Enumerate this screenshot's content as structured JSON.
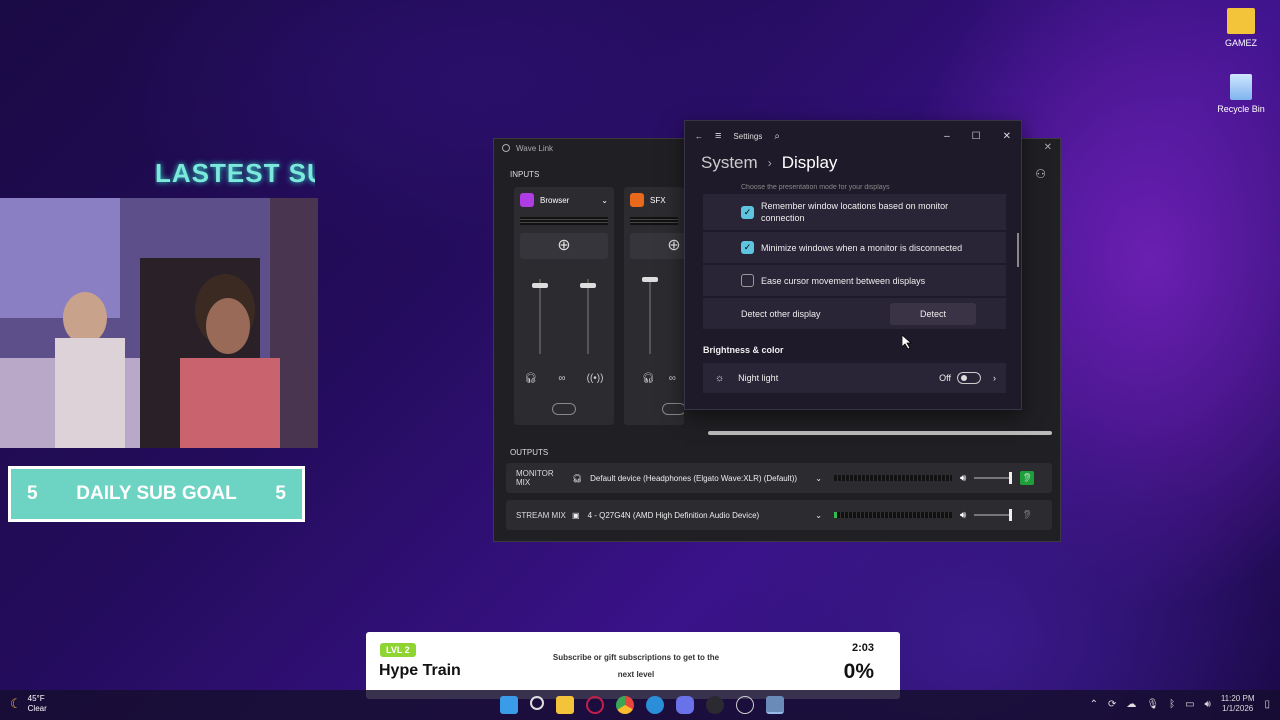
{
  "desktop": {
    "icons": [
      {
        "label": "GAMEZ",
        "icon": "folder-icon"
      },
      {
        "label": "Recycle Bin",
        "icon": "recycle-bin-icon"
      }
    ]
  },
  "overlay": {
    "latest_label": "LASTEST SU",
    "subgoal": {
      "left": "5",
      "label": "DAILY SUB GOAL",
      "right": "5"
    }
  },
  "wavelink": {
    "title": "Wave Link",
    "inputs_label": "INPUTS",
    "channels": [
      {
        "name": "Browser",
        "color": "#b03ce6"
      },
      {
        "name": "SFX",
        "color": "#e8691c"
      }
    ],
    "outputs_label": "OUTPUTS",
    "outputs": [
      {
        "label": "MONITOR MIX",
        "device": "Default device (Headphones (Elgato Wave:XLR) (Default))"
      },
      {
        "label": "STREAM MIX",
        "device": "4 - Q27G4N (AMD High Definition Audio Device)"
      }
    ]
  },
  "settings": {
    "window_title": "Settings",
    "breadcrumb_parent": "System",
    "breadcrumb_sep": "›",
    "breadcrumb_current": "Display",
    "cut_text": "Choose the presentation mode for your displays",
    "options": [
      {
        "label": "Remember window locations based on monitor connection",
        "checked": true
      },
      {
        "label": "Minimize windows when a monitor is disconnected",
        "checked": true
      },
      {
        "label": "Ease cursor movement between displays",
        "checked": false
      }
    ],
    "detect_label": "Detect other display",
    "detect_button": "Detect",
    "section_brightness": "Brightness & color",
    "night_light_label": "Night light",
    "night_light_state": "Off"
  },
  "hype_train": {
    "level": "LVL 2",
    "title": "Hype Train",
    "message": "Subscribe or gift subscriptions to get to the next level",
    "timer": "2:03",
    "percent": "0%"
  },
  "taskbar": {
    "weather_temp": "45°F",
    "weather_desc": "Clear",
    "time": "11:20 PM",
    "date": "1/1/2026"
  }
}
